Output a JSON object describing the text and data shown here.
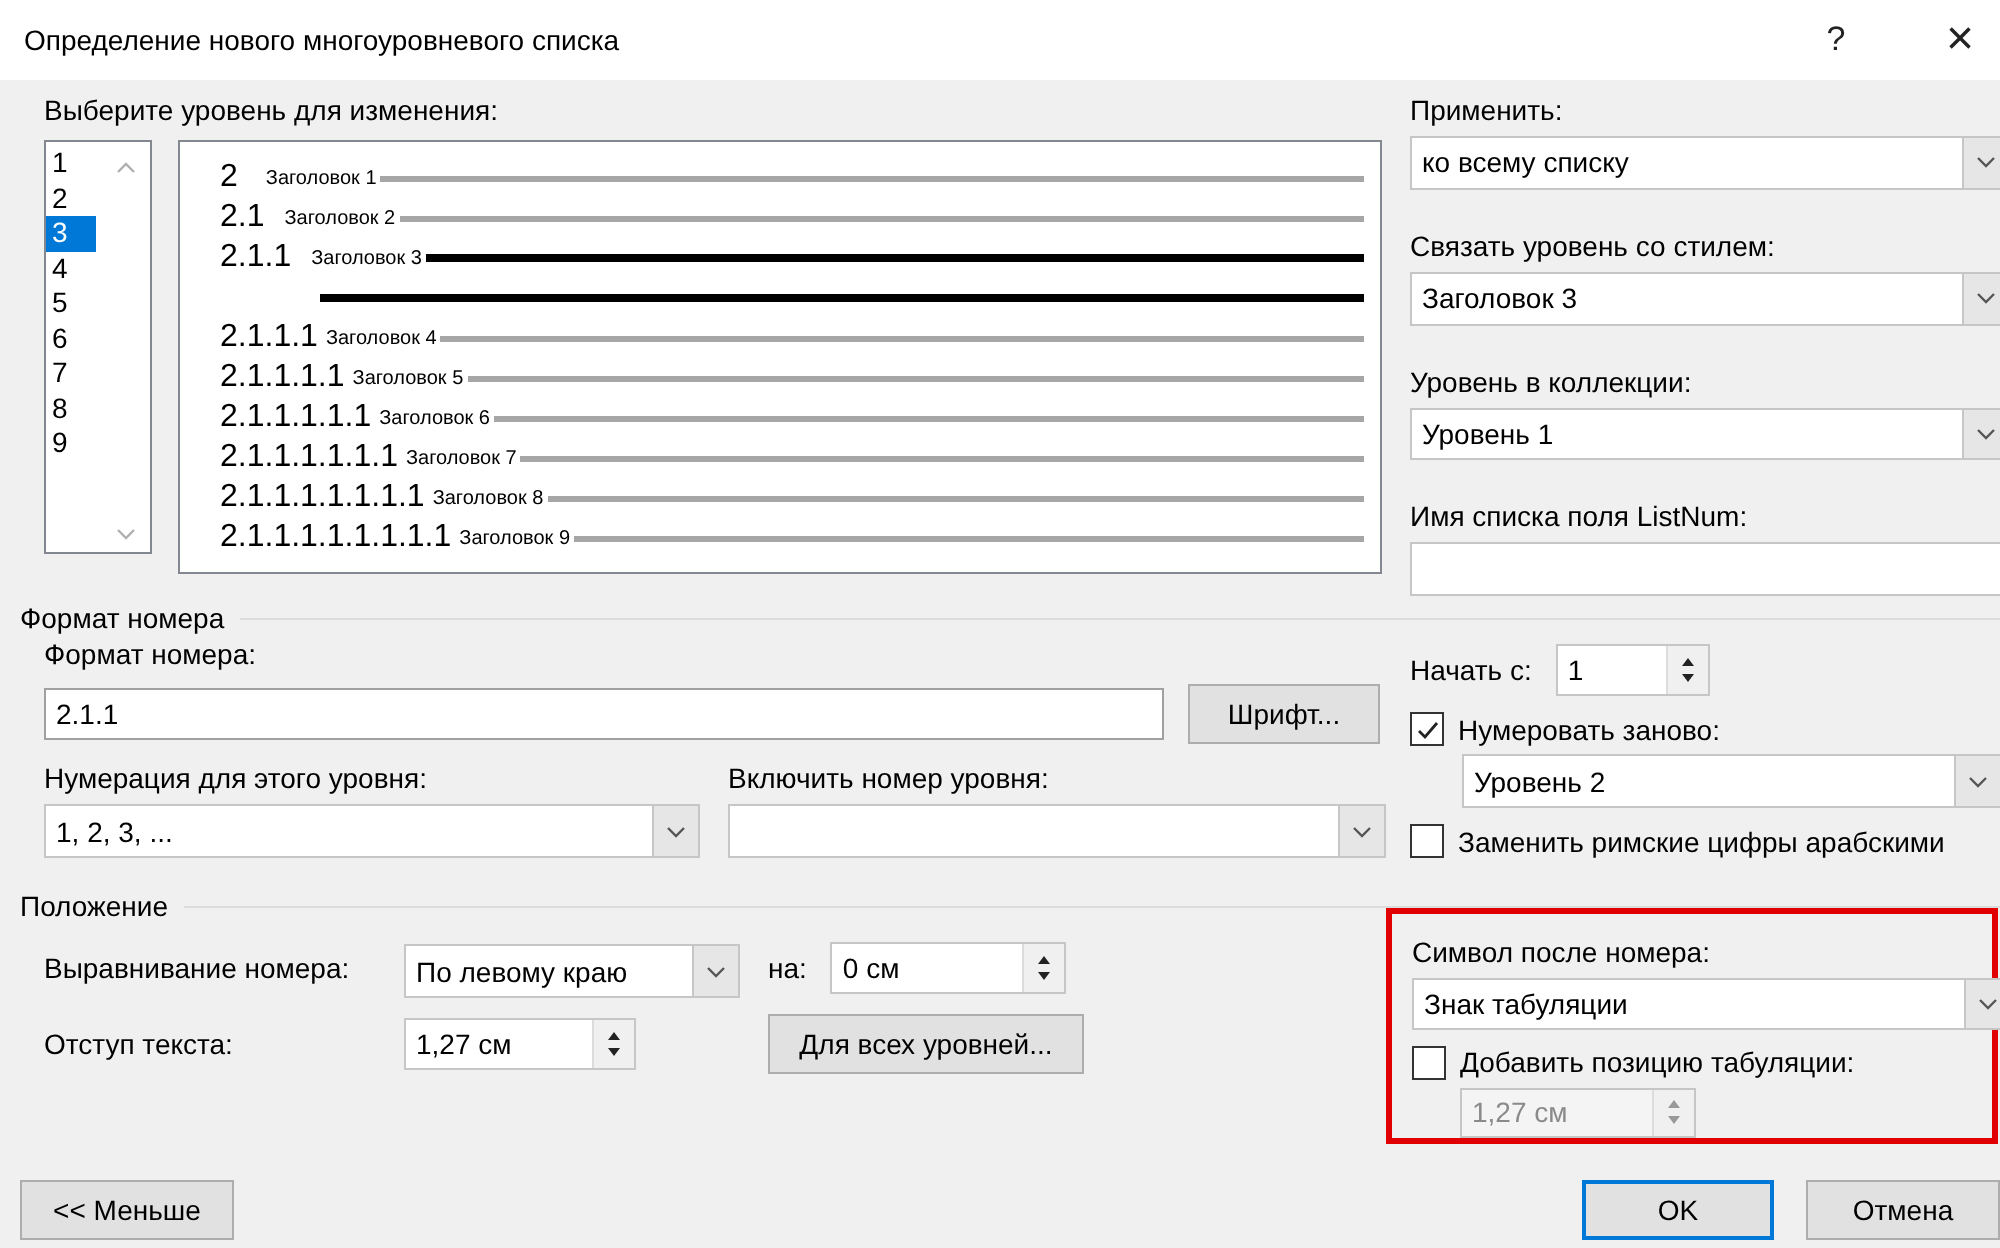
{
  "window": {
    "title": "Определение нового многоуровневого списка",
    "help": "?",
    "close": "×"
  },
  "level_picker": {
    "label": "Выберите уровень для изменения:",
    "levels": [
      {
        "label": "1",
        "selected": false
      },
      {
        "label": "2",
        "selected": false
      },
      {
        "label": "3",
        "selected": true
      },
      {
        "label": "4",
        "selected": false
      },
      {
        "label": "5",
        "selected": false
      },
      {
        "label": "6",
        "selected": false
      },
      {
        "label": "7",
        "selected": false
      },
      {
        "label": "8",
        "selected": false
      },
      {
        "label": "9",
        "selected": false
      }
    ]
  },
  "preview": [
    {
      "number": "2",
      "style": "Заголовок 1",
      "selected": false
    },
    {
      "number": "2.1",
      "style": "Заголовок 2",
      "selected": false
    },
    {
      "number": "2.1.1",
      "style": "Заголовок 3",
      "selected": true
    },
    {
      "number": "2.1.1.1",
      "style": "Заголовок 4",
      "selected": false
    },
    {
      "number": "2.1.1.1.1",
      "style": "Заголовок 5",
      "selected": false
    },
    {
      "number": "2.1.1.1.1.1",
      "style": "Заголовок 6",
      "selected": false
    },
    {
      "number": "2.1.1.1.1.1.1",
      "style": "Заголовок 7",
      "selected": false
    },
    {
      "number": "2.1.1.1.1.1.1.1",
      "style": "Заголовок 8",
      "selected": false
    },
    {
      "number": "2.1.1.1.1.1.1.1.1",
      "style": "Заголовок 9",
      "selected": false
    }
  ],
  "apply": {
    "label": "Применить:",
    "value": "ко всему списку"
  },
  "link_style": {
    "label": "Связать уровень со стилем:",
    "value": "Заголовок 3"
  },
  "gallery_level": {
    "label": "Уровень в коллекции:",
    "value": "Уровень 1"
  },
  "listnum": {
    "label": "Имя списка поля ListNum:"
  },
  "number_format": {
    "heading": "Формат номера",
    "format_label": "Формат номера:",
    "format_value": "2.1.1",
    "font_button": "Шрифт...",
    "style_label": "Нумерация для этого уровня:",
    "style_value": "1, 2, 3, ...",
    "include_label": "Включить номер уровня:"
  },
  "start": {
    "label": "Начать с:",
    "value": "1"
  },
  "restart": {
    "label": "Нумеровать заново:",
    "checked": true,
    "value": "Уровень 2"
  },
  "legal": {
    "label": "Заменить римские цифры арабскими",
    "checked": false
  },
  "position": {
    "heading": "Положение",
    "align_label": "Выравнивание номера:",
    "align_value": "По левому краю",
    "at_label": "на:",
    "at_value": "0 см",
    "indent_label": "Отступ текста:",
    "indent_value": "1,27 см",
    "all_levels_button": "Для всех уровней..."
  },
  "follow": {
    "label": "Символ после номера:",
    "value": "Знак табуляции",
    "add_tab": {
      "label": "Добавить позицию табуляции:",
      "checked": false
    },
    "tab_value": "1,27 см",
    "tab_disabled": true
  },
  "buttons": {
    "less": "<< Меньше",
    "ok": "OK",
    "cancel": "Отмена"
  }
}
